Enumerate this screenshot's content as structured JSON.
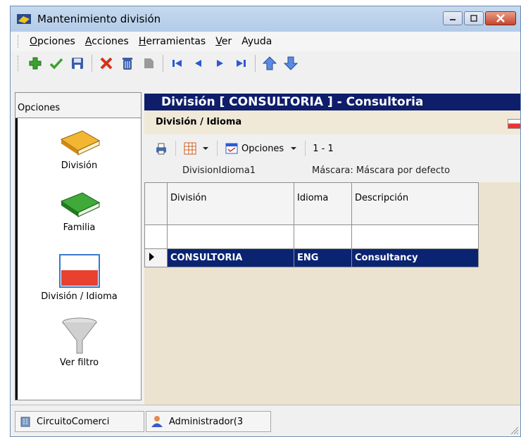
{
  "window": {
    "title": "Mantenimiento división"
  },
  "menu": {
    "items": [
      {
        "underline": "O",
        "rest": "pciones"
      },
      {
        "underline": "A",
        "rest": "cciones"
      },
      {
        "underline": "H",
        "rest": "erramientas"
      },
      {
        "underline": "V",
        "rest": "er"
      },
      {
        "underline": "",
        "rest": "Ayuda"
      }
    ]
  },
  "left_panel": {
    "header": "Opciones",
    "items": [
      {
        "label": "División",
        "icon": "book-yellow-icon"
      },
      {
        "label": "Familia",
        "icon": "book-green-icon"
      },
      {
        "label": "División / Idioma",
        "icon": "flag-icon"
      },
      {
        "label": "Ver filtro",
        "icon": "funnel-icon"
      }
    ]
  },
  "main": {
    "title": "División   [ CONSULTORIA ] - Consultoria",
    "subtitle": "División / Idioma",
    "grid_toolbar": {
      "options_label": "Opciones",
      "range": "1 - 1"
    },
    "grid_caption": {
      "name": "DivisionIdioma1",
      "mask": "Máscara: Máscara por defecto"
    },
    "table": {
      "columns": [
        "División",
        "Idioma",
        "Descripción"
      ],
      "rows": [
        [
          "CONSULTORIA",
          "ENG",
          "Consultancy"
        ]
      ]
    }
  },
  "status": {
    "company": "CircuitoComerci",
    "user": "Administrador(3"
  },
  "colors": {
    "title_bar": "#0e1e6b",
    "selection": "#0a2472",
    "grid_background": "#ebe3cf"
  }
}
